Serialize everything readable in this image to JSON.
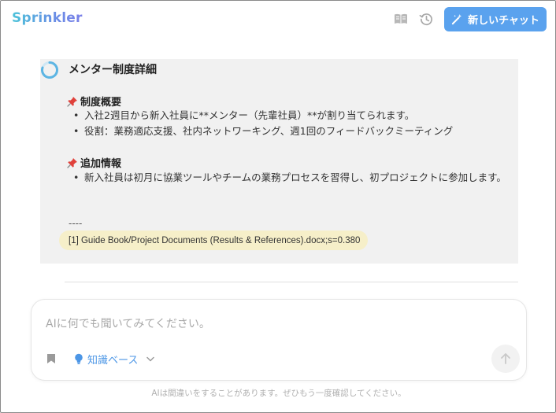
{
  "header": {
    "logo": "Sprinkler",
    "new_chat_label": "新しいチャット",
    "icons": [
      "book-icon",
      "history-icon",
      "magic-wand-icon"
    ]
  },
  "message": {
    "title": "メンター制度詳細",
    "sections": [
      {
        "heading": "制度概要",
        "bullets": [
          "入社2週目から新入社員に**メンター（先輩社員）**が割り当てられます。",
          "役割：業務適応支援、社内ネットワーキング、週1回のフィードバックミーティング"
        ]
      },
      {
        "heading": "追加情報",
        "bullets": [
          "新入社員は初月に協業ツールやチームの業務プロセスを習得し、初プロジェクトに参加します。"
        ]
      }
    ],
    "separator": "----",
    "reference": "[1] Guide Book/Project Documents (Results & References).docx;s=0.380"
  },
  "input": {
    "placeholder": "AIに何でも聞いてみてください。",
    "knowledge_base_label": "知識ベース"
  },
  "footer_note": "AIは間違いをすることがあります。ぜひもう一度確認してください。",
  "colors": {
    "accent": "#5aa2ee",
    "link": "#4c96e6",
    "card_bg": "#f1f1f1",
    "reference_bg": "#f6efc9"
  }
}
